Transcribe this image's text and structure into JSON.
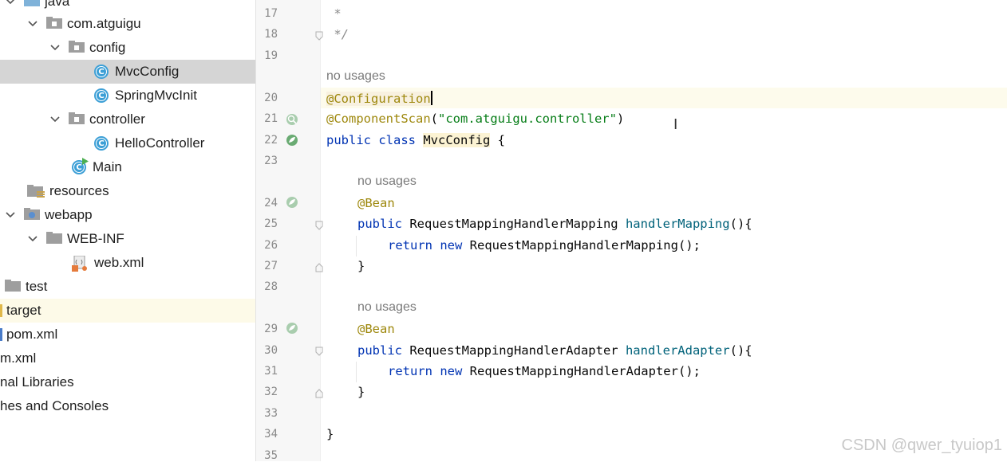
{
  "project_tree": {
    "items": [
      {
        "label": "java"
      },
      {
        "label": "com.atguigu"
      },
      {
        "label": "config"
      },
      {
        "label": "MvcConfig"
      },
      {
        "label": "SpringMvcInit"
      },
      {
        "label": "controller"
      },
      {
        "label": "HelloController"
      },
      {
        "label": "Main"
      },
      {
        "label": "resources"
      },
      {
        "label": "webapp"
      },
      {
        "label": "WEB-INF"
      },
      {
        "label": "web.xml"
      },
      {
        "label": "test"
      },
      {
        "label": "target"
      },
      {
        "label": "pom.xml"
      },
      {
        "label": "m.xml"
      },
      {
        "label": "nal Libraries"
      },
      {
        "label": "hes and Consoles"
      }
    ]
  },
  "editor": {
    "line_numbers": [
      "17",
      "18",
      "19",
      "20",
      "21",
      "22",
      "23",
      "24",
      "25",
      "26",
      "27",
      "28",
      "29",
      "30",
      "31",
      "32",
      "33",
      "34",
      "35"
    ],
    "hints": {
      "h1": "no usages",
      "h2": "no usages",
      "h3": "no usages"
    },
    "lines": {
      "l17": " *",
      "l18": " */",
      "l20_ann": "@Configuration",
      "l21_ann": "@ComponentScan",
      "l21_paren_open": "(",
      "l21_str": "\"com.atguigu.controller\"",
      "l21_paren_close": ")",
      "l22_kw": "public class ",
      "l22_cls": "MvcConfig",
      "l22_rest": " {",
      "l24_ann": "@Bean",
      "l25_kw": "public ",
      "l25_type": "RequestMappingHandlerMapping ",
      "l25_fn": "handlerMapping",
      "l25_rest": "(){",
      "l26_kw": "return new ",
      "l26_rest": "RequestMappingHandlerMapping();",
      "l27": "}",
      "l29_ann": "@Bean",
      "l30_kw": "public ",
      "l30_type": "RequestMappingHandlerAdapter ",
      "l30_fn": "handlerAdapter",
      "l30_rest": "(){",
      "l31_kw": "return new ",
      "l31_rest": "RequestMappingHandlerAdapter();",
      "l32": "}",
      "l34": "}"
    }
  },
  "watermark": "CSDN @qwer_tyuiop1",
  "colors": {
    "keyword": "#0033b3",
    "annotation": "#9e880d",
    "string": "#067d17",
    "method": "#00627a",
    "java_class_icon": "#3c9fd6",
    "spring_bean_icon": "#6aab73"
  }
}
